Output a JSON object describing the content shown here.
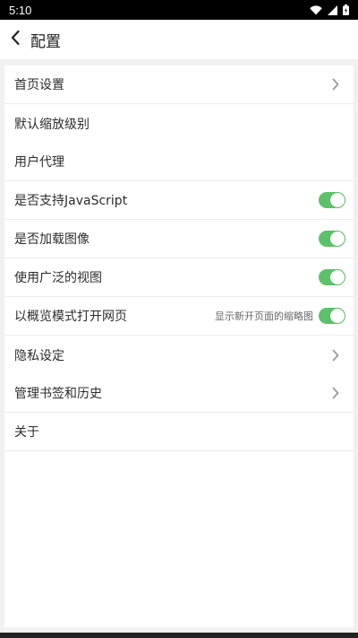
{
  "status_bar": {
    "time": "5:10",
    "icons": [
      "wifi-icon",
      "signal-icon",
      "battery-icon"
    ]
  },
  "toolbar": {
    "back_icon": "chevron-left-icon",
    "title": "配置"
  },
  "colors": {
    "accent": "#5bc26a",
    "background": "#f1f1f1",
    "card": "#ffffff"
  },
  "settings": {
    "items": [
      {
        "label": "首页设置",
        "type": "link"
      },
      {
        "label": "默认缩放级别",
        "type": "plain"
      },
      {
        "label": "用户代理",
        "type": "plain"
      },
      {
        "label": "是否支持JavaScript",
        "type": "toggle",
        "on": true
      },
      {
        "label": "是否加载图像",
        "type": "toggle",
        "on": true
      },
      {
        "label": "使用广泛的视图",
        "type": "toggle",
        "on": true
      },
      {
        "label": "以概览模式打开网页",
        "hint": "显示新开页面的缩略图",
        "type": "toggle",
        "on": true
      },
      {
        "label": "隐私设定",
        "type": "link"
      },
      {
        "label": "管理书签和历史",
        "type": "link"
      },
      {
        "label": "关于",
        "type": "plain"
      }
    ]
  }
}
